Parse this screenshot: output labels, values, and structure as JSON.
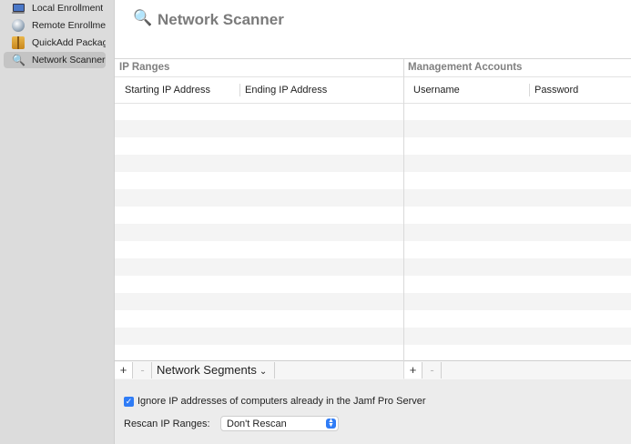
{
  "sidebar": {
    "items": [
      {
        "label": "Local Enrollment",
        "icon": "laptop-icon"
      },
      {
        "label": "Remote Enrollment",
        "icon": "globe-icon"
      },
      {
        "label": "QuickAdd Package",
        "icon": "package-icon"
      },
      {
        "label": "Network Scanner",
        "icon": "magnifier-icon",
        "selected": true
      }
    ]
  },
  "header": {
    "title": "Network Scanner",
    "icon_glyph": "🔍"
  },
  "ip_ranges": {
    "title": "IP Ranges",
    "columns": [
      "Starting IP Address",
      "Ending IP Address"
    ],
    "add_label": "+",
    "remove_label": "-",
    "segments_label": "Network Segments"
  },
  "management_accounts": {
    "title": "Management Accounts",
    "columns": [
      "Username",
      "Password"
    ],
    "add_label": "+",
    "remove_label": "-"
  },
  "options": {
    "ignore_checkbox_label": "Ignore IP addresses of computers already in the Jamf Pro Server",
    "ignore_checked": true,
    "rescan_label": "Rescan IP Ranges:",
    "rescan_value": "Don't Rescan"
  }
}
